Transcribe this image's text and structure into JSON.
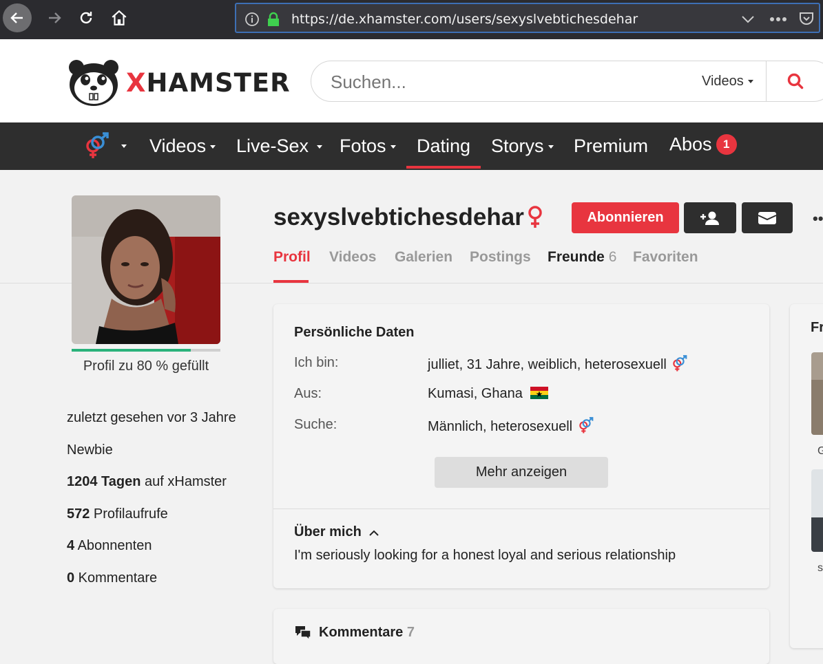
{
  "browser": {
    "url": "https://de.xhamster.com/users/sexyslvebtichesdehar"
  },
  "header": {
    "logo_text": "XHAMSTER",
    "search_placeholder": "Suchen...",
    "search_scope": "Videos"
  },
  "nav": {
    "items": [
      {
        "label": "Videos",
        "dropdown": true
      },
      {
        "label": "Live-Sex",
        "dropdown": true
      },
      {
        "label": "Fotos",
        "dropdown": true
      },
      {
        "label": "Dating",
        "dropdown": false,
        "active": true
      },
      {
        "label": "Storys",
        "dropdown": true
      },
      {
        "label": "Premium",
        "dropdown": false
      },
      {
        "label": "Abos",
        "dropdown": false,
        "badge": "1"
      }
    ]
  },
  "profile": {
    "username": "sexyslvebtichesdehar",
    "subscribe_label": "Abonnieren",
    "completion_label": "Profil zu 80 % gefüllt",
    "completion_fraction": 0.8,
    "tabs": [
      {
        "label": "Profil",
        "active": true
      },
      {
        "label": "Videos"
      },
      {
        "label": "Galerien"
      },
      {
        "label": "Postings"
      },
      {
        "label": "Freunde",
        "count": "6"
      },
      {
        "label": "Favoriten"
      }
    ]
  },
  "stats": {
    "last_seen": "zuletzt gesehen vor 3 Jahre",
    "level": "Newbie",
    "days_value": "1204 Tagen",
    "days_suffix": " auf xHamster",
    "views_value": "572",
    "views_suffix": " Profilaufrufe",
    "subs_value": "4",
    "subs_suffix": " Abonnenten",
    "comments_value": "0",
    "comments_suffix": " Kommentare"
  },
  "personal": {
    "title": "Persönliche Daten",
    "rows": [
      {
        "label": "Ich bin:",
        "value": "julliet, 31 Jahre, weiblich, heterosexuell"
      },
      {
        "label": "Aus:",
        "value": "Kumasi, Ghana"
      },
      {
        "label": "Suche:",
        "value": "Männlich, heterosexuell"
      }
    ],
    "more_label": "Mehr anzeigen",
    "about_title": "Über mich",
    "about_text": "I'm seriously looking for a honest loyal and serious relationship"
  },
  "comments": {
    "title": "Kommentare",
    "count": "7"
  },
  "right_panel": {
    "title": "Fr",
    "friend_label_1": "G",
    "friend_label_2": "s"
  },
  "colors": {
    "accent": "#e8353f",
    "nav_bg": "#2e2e2e",
    "progress": "#2ab27b"
  }
}
